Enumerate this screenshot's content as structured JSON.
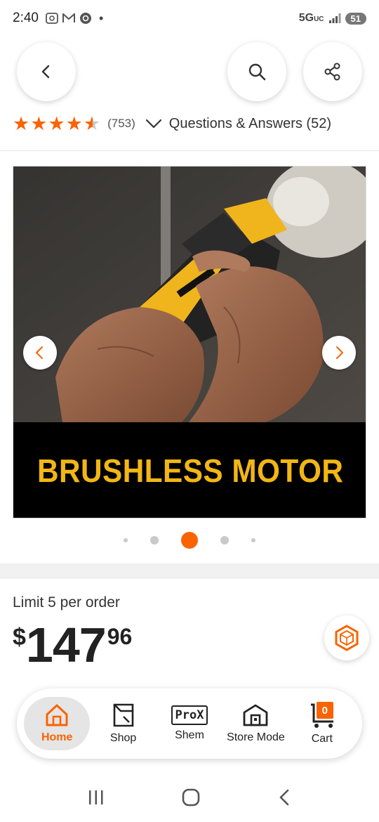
{
  "status_bar": {
    "time": "2:40",
    "network": "5G",
    "network_sub": "UC",
    "battery": "51"
  },
  "rating": {
    "count": "(753)",
    "qa_label": "Questions & Answers (52)",
    "stars_value": 4.5
  },
  "gallery": {
    "banner_text": "BRUSHLESS MOTOR",
    "dots_total": 5,
    "active_dot": 3
  },
  "purchase": {
    "limit_text": "Limit 5 per order",
    "price_currency": "$",
    "price_dollars": "147",
    "price_cents": "96"
  },
  "bottom_nav": {
    "items": [
      {
        "label": "Home",
        "icon": "home-icon"
      },
      {
        "label": "Shop",
        "icon": "shop-icon"
      },
      {
        "label": "Shem",
        "icon": "prox-icon"
      },
      {
        "label": "Store Mode",
        "icon": "store-icon"
      },
      {
        "label": "Cart",
        "icon": "cart-icon"
      }
    ],
    "prox_text": "ProX",
    "cart_count": "0"
  },
  "colors": {
    "accent": "#f96302",
    "banner_text": "#f2b615"
  }
}
